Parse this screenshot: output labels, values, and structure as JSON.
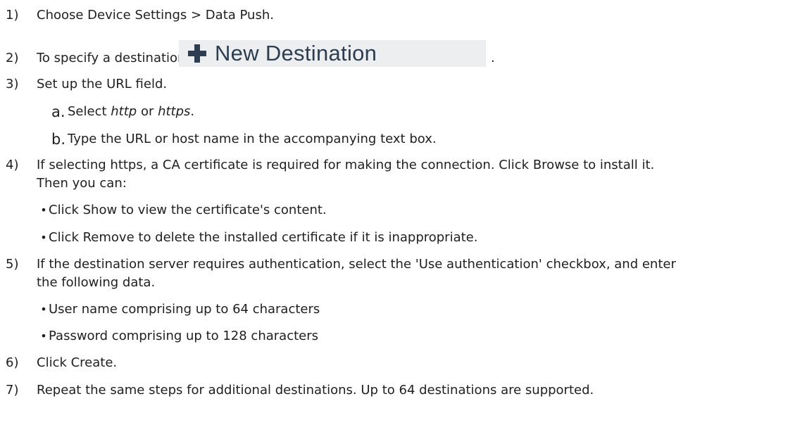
{
  "steps": {
    "s1": {
      "num": "1)",
      "text": "Choose Device Settings > Data Push."
    },
    "s2": {
      "num": "2)",
      "text": "To specify a destination, click",
      "button_label": "New Destination",
      "button_icon": "plus-icon",
      "suffix": "."
    },
    "s3": {
      "num": "3)",
      "text": "Set up the URL field.",
      "a": {
        "letter": "a.",
        "prefix": "Select ",
        "http": "http",
        "or": " or ",
        "https": "https",
        "suffix": "."
      },
      "b": {
        "letter": "b.",
        "text": "Type the URL or host name in the accompanying text box."
      }
    },
    "s4": {
      "num": "4)",
      "line1": "If selecting https, a CA certificate is required for making the connection. Click Browse to install it.",
      "line2": "Then you can:",
      "bullets": [
        "Click Show to view the certificate's content.",
        "Click Remove to delete the installed certificate if it is inappropriate."
      ]
    },
    "s5": {
      "num": "5)",
      "line1": "If the destination server requires authentication, select the 'Use authentication' checkbox, and enter",
      "line2": "the following data.",
      "bullets": [
        "User name comprising up to 64 characters",
        "Password comprising up to 128 characters"
      ]
    },
    "s6": {
      "num": "6)",
      "text": "Click Create."
    },
    "s7": {
      "num": "7)",
      "text": "Repeat the same steps for additional destinations. Up to 64 destinations are supported."
    }
  },
  "bullet_char": "•",
  "colors": {
    "text": "#1f1f1f",
    "button_bg": "#eceeef",
    "button_text": "#2c3e50"
  }
}
